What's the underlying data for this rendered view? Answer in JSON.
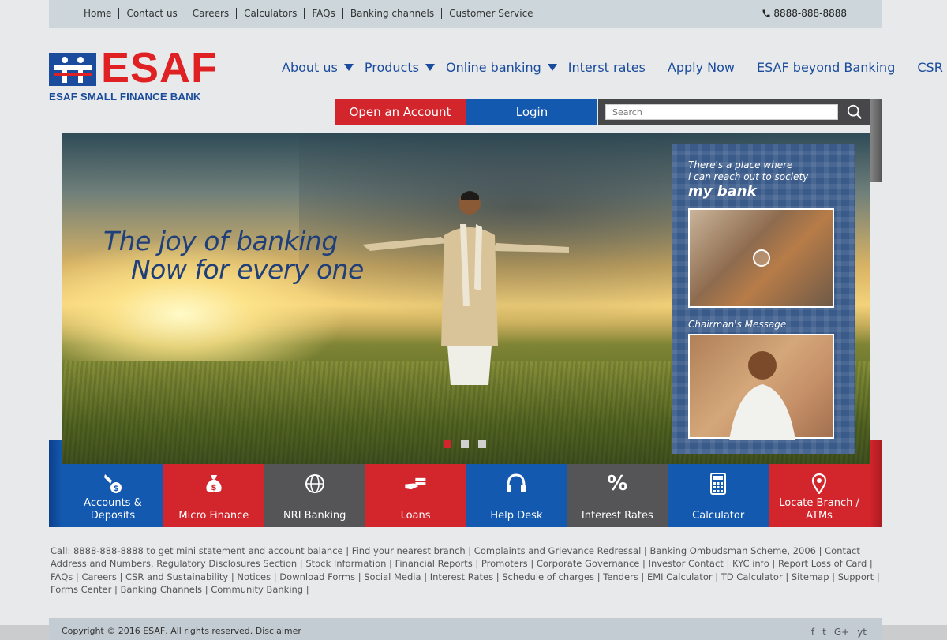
{
  "topbar": {
    "links": [
      "Home",
      "Contact us",
      "Careers",
      "Calculators",
      "FAQs",
      "Banking channels",
      "Customer Service"
    ],
    "phone": "8888-888-8888"
  },
  "logo": {
    "brand": "ESAF",
    "subtitle": "ESAF SMALL FINANCE BANK"
  },
  "nav": {
    "items": [
      {
        "label": "About us",
        "dropdown": true
      },
      {
        "label": "Products",
        "dropdown": true
      },
      {
        "label": "Online banking",
        "dropdown": true
      },
      {
        "label": "Interst rates",
        "dropdown": false
      },
      {
        "label": "Apply Now",
        "dropdown": false
      },
      {
        "label": "ESAF beyond Banking",
        "dropdown": false
      },
      {
        "label": "CSR",
        "dropdown": false
      }
    ]
  },
  "actions": {
    "open_account": "Open an Account",
    "login": "Login",
    "search_placeholder": "Search"
  },
  "hero": {
    "line1": "The joy of banking",
    "line2": "Now for every one",
    "side_text1": "There's a place where",
    "side_text2": "i can reach out to society",
    "side_title": "my bank",
    "chairman": "Chairman's Message",
    "slides": 3,
    "active_slide": 1
  },
  "quick_links": [
    {
      "label": "Accounts & Deposits",
      "icon": "coin-hand-icon",
      "color": "blue"
    },
    {
      "label": "Micro Finance",
      "icon": "money-bag-icon",
      "color": "red"
    },
    {
      "label": "NRI Banking",
      "icon": "globe-icon",
      "color": "grey"
    },
    {
      "label": "Loans",
      "icon": "hand-cash-icon",
      "color": "red"
    },
    {
      "label": "Help Desk",
      "icon": "headphones-icon",
      "color": "blue"
    },
    {
      "label": "Interest Rates",
      "icon": "percent-icon",
      "color": "grey"
    },
    {
      "label": "Calculator",
      "icon": "calculator-icon",
      "color": "blue"
    },
    {
      "label": "Locate Branch / ATMs",
      "icon": "location-pin-icon",
      "color": "red"
    }
  ],
  "footer": {
    "links_text": "Call: 8888-888-8888 to get mini statement and account balance | Find your nearest branch | Complaints and Grievance Redressal | Banking Ombudsman Scheme, 2006 | Contact Address and Numbers, Regulatory Disclosures Section | Stock Information | Financial Reports | Promoters | Corporate Governance | Investor Contact | KYC info | Report Loss of Card | FAQs | Careers | CSR and Sustainability | Notices | Download Forms | Social Media | Interest Rates | Schedule of charges | Tenders | EMI Calculator | TD Calculator | Sitemap | Support | Forms Center | Banking Channels | Community Banking |",
    "copyright": "Copyright © 2016 ESAF, All rights reserved. Disclaimer",
    "social": [
      "f",
      "t",
      "G+",
      "yt"
    ]
  },
  "colors": {
    "brand_blue": "#1a4b9c",
    "brand_red": "#e02124",
    "tile_blue": "#1459b0",
    "tile_red": "#d3252c",
    "tile_grey": "#555557"
  }
}
